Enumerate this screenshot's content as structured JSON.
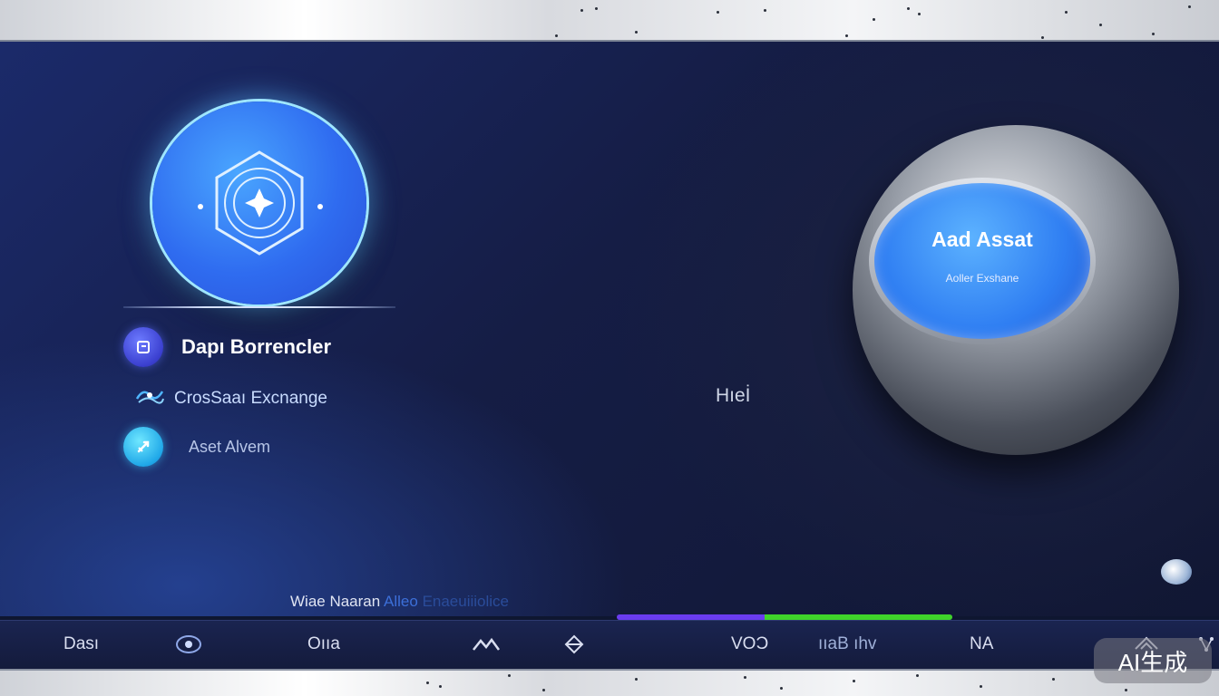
{
  "logo": {
    "icon": "hexagon-star-icon"
  },
  "menu": {
    "items": [
      {
        "label": "Dapı Borrencler",
        "icon": "wallet-icon"
      },
      {
        "label": "CrosSaaı Excnange",
        "icon": "exchange-icon"
      },
      {
        "label": "Aset Alvem",
        "icon": "rocket-icon"
      }
    ]
  },
  "center_label": "Hıeİ",
  "add_asset": {
    "title": "Aad Assat",
    "subtitle": "Aoller Exshane"
  },
  "footer_caption": {
    "part1": "Wiae Naaran",
    "part2": "Alleo",
    "part3": "Enaeuiiiolice"
  },
  "progress": {
    "segments": [
      {
        "color": "#6a3cf0",
        "start": 0.0,
        "end": 0.44
      },
      {
        "color": "#3fd42a",
        "start": 0.44,
        "end": 1.0
      }
    ]
  },
  "bottom_bar": {
    "items": [
      {
        "label": "Dası"
      },
      {
        "icon": "globe-icon"
      },
      {
        "label": "Oııa"
      },
      {
        "icon": "mountain-icon"
      },
      {
        "icon": "diamond-icon"
      },
      {
        "label": "VOƆ"
      },
      {
        "label": "ııaB ıhv"
      },
      {
        "label": "NA"
      },
      {
        "icon": "wing-icon"
      },
      {
        "icon": "node-icon"
      }
    ]
  },
  "watermark": "AI生成",
  "colors": {
    "accent": "#2f7ef2",
    "background": "#151d45",
    "metal": "#9aa0aa"
  }
}
